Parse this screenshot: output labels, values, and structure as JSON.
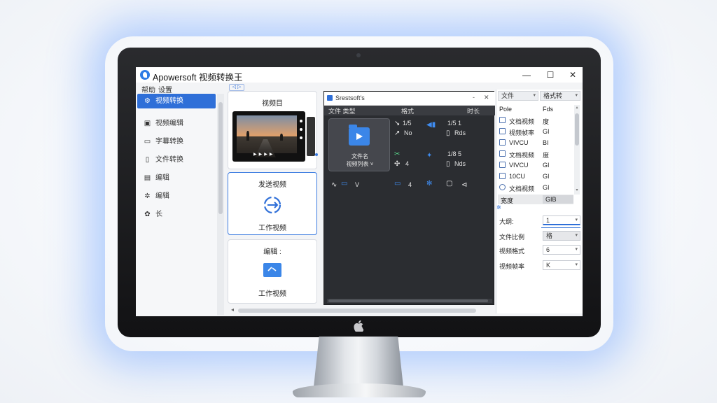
{
  "app": {
    "title": "Apowersoft 视频转换王",
    "window": {
      "minimize": "—",
      "maximize": "☐",
      "close": "✕"
    }
  },
  "menu": [
    "帮助",
    "设置"
  ],
  "sidebar": {
    "items": [
      {
        "label": "视频转换",
        "icon": "gear-icon",
        "active": true
      },
      {
        "label": "视频编辑",
        "icon": "film-icon",
        "active": false
      },
      {
        "label": "字幕转换",
        "icon": "screen-icon",
        "active": false
      },
      {
        "label": "文件转换",
        "icon": "doc-icon",
        "active": false
      },
      {
        "label": "编辑",
        "icon": "edit-icon",
        "active": false
      },
      {
        "label": "编辑",
        "icon": "settings-icon",
        "active": false
      },
      {
        "label": "长",
        "icon": "gear-icon",
        "active": false
      }
    ]
  },
  "middle": {
    "tab": "◁ ▷",
    "cards": [
      {
        "title": "视频目"
      },
      {
        "title": "发送视频",
        "subtitle": "工作视频"
      },
      {
        "title": "编辑 :",
        "subtitle": "工作视频"
      }
    ]
  },
  "dark_panel": {
    "header_title": "Srestsoft's",
    "header_buttons": [
      "-",
      "✕"
    ],
    "columns": [
      "文件 类型",
      "格式",
      "时长"
    ],
    "tile": {
      "line1": "文件名",
      "line2": "视频列表 ˅"
    },
    "cells": {
      "r1c2_top": "1/5",
      "r1c2_bottom": "No",
      "r1c3_top": "1/5 1",
      "r1c3_bottom": "Rds",
      "r2c2_bottom": "4",
      "r2c3_top": "1/8 5",
      "r2c3_bottom": "Nds",
      "r3c1": "V",
      "r3c2": "4"
    }
  },
  "right_panel": {
    "headers": [
      "文件",
      "格式转"
    ],
    "rows": [
      {
        "name": "Pole",
        "value": "Fds"
      },
      {
        "name": "文档视频",
        "value": "度"
      },
      {
        "name": "视频帧率",
        "value": "GI"
      },
      {
        "name": "VIVCU",
        "value": "BI"
      },
      {
        "name": "文档视频",
        "value": "度"
      },
      {
        "name": "VIVCU",
        "value": "GI"
      },
      {
        "name": "10CU",
        "value": "GI"
      },
      {
        "name": "文档视频",
        "value": "GI"
      }
    ],
    "selected": {
      "name": "宽度",
      "value": "GIB"
    },
    "props": [
      {
        "label": "大纲:",
        "value": "1"
      },
      {
        "label": "文件比例",
        "value": "格"
      },
      {
        "label": "视频格式",
        "value": "6"
      },
      {
        "label": "视频帧率",
        "value": "K"
      }
    ]
  },
  "colors": {
    "accent": "#2f6fd8",
    "dark": "#2b2d31",
    "glow": "#5a96ff"
  }
}
